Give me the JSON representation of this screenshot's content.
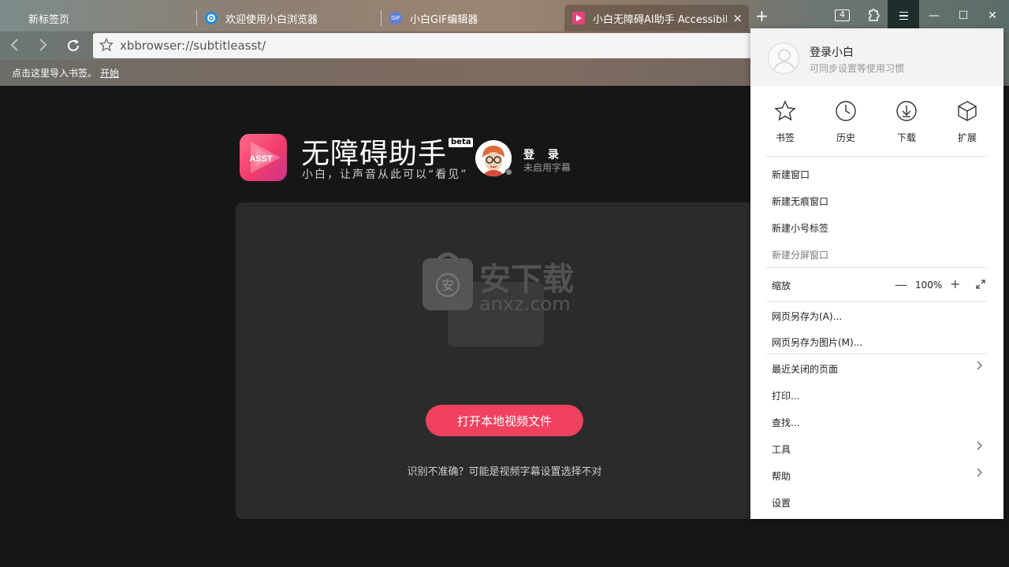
{
  "tabs": [
    {
      "label": "新标签页",
      "active": false
    },
    {
      "label": "欢迎使用小白浏览器",
      "active": false,
      "icon": "browser-logo-icon"
    },
    {
      "label": "小白GIF编辑器",
      "active": false,
      "icon": "gif-icon",
      "icon_text": "GIF"
    },
    {
      "label": "小白无障碍AI助手 Accessibilit",
      "active": true,
      "icon": "play-icon"
    }
  ],
  "titlebar": {
    "tab_count": "4",
    "new_tab": "+",
    "close_tab": "×"
  },
  "window_controls": {
    "minimize": "—",
    "maximize": "☐",
    "close": "✕"
  },
  "address_bar": {
    "url": "xbbrowser://subtitleasst/"
  },
  "bookmarks_bar": {
    "message": "点击这里导入书签。",
    "start_link": "开始"
  },
  "app": {
    "logo_text": "ASST",
    "title": "无障碍助手",
    "badge": "beta",
    "slogan": "小白，让声音从此可以“看见”",
    "login": "登 录",
    "subtitle_status": "未启用字幕",
    "open_button": "打开本地视频文件",
    "hint": "识别不准确？可能是视频字幕设置选择不对",
    "watermark": {
      "title": "安下载",
      "domain": "anxz.com",
      "badge": "安"
    }
  },
  "menu": {
    "user": {
      "name": "登录小白",
      "sub": "可同步设置等使用习惯"
    },
    "quick_actions": [
      {
        "label": "书签",
        "icon": "star-icon"
      },
      {
        "label": "历史",
        "icon": "clock-icon"
      },
      {
        "label": "下载",
        "icon": "download-icon"
      },
      {
        "label": "扩展",
        "icon": "cube-icon"
      }
    ],
    "new_window": "新建窗口",
    "new_incognito": "新建无痕窗口",
    "new_small_tab": "新建小号标签",
    "new_split": "新建分屏窗口",
    "zoom_label": "缩放",
    "zoom_value": "100%",
    "zoom_minus": "—",
    "zoom_plus": "+",
    "save_page": "网页另存为(A)...",
    "save_image": "网页另存为图片(M)...",
    "recent_closed": "最近关闭的页面",
    "print": "打印...",
    "find": "查找...",
    "tools": "工具",
    "help": "帮助",
    "settings": "设置"
  },
  "colors": {
    "accent": "#f0415f",
    "panel": "#2b2b2b",
    "menu_bg": "#ffffff"
  }
}
